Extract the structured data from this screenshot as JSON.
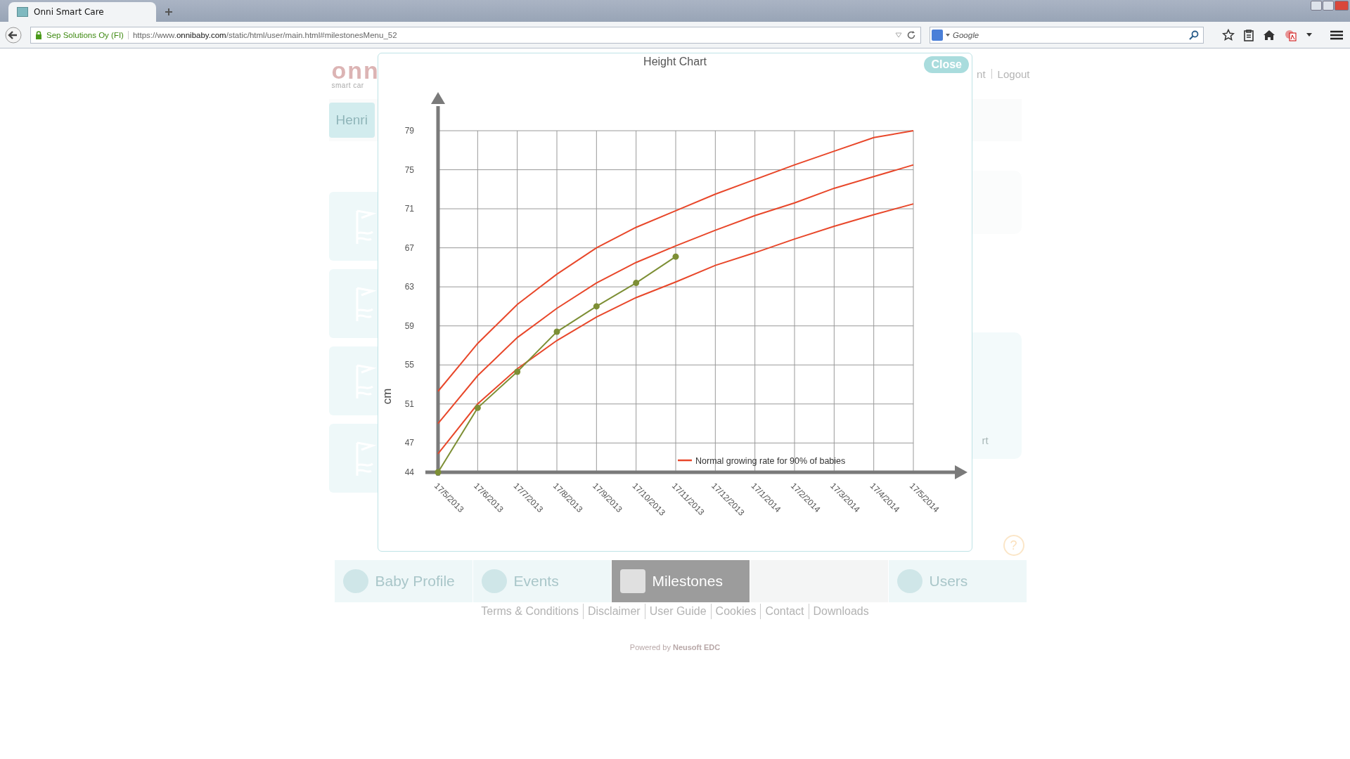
{
  "browser": {
    "tab_title": "Onni Smart Care",
    "identity": "Sep Solutions Oy (FI)",
    "url_prefix": "https://www.",
    "url_domain": "onnibaby.com",
    "url_path": "/static/html/user/main.html#milestonesMenu_52",
    "search_placeholder": "Google"
  },
  "page": {
    "logo": {
      "text": "onn",
      "tagline": "smart car"
    },
    "header_links": [
      "nt",
      "Logout"
    ],
    "profile_name": "Henri",
    "side_fragment": "rt",
    "help": "?",
    "nav_tabs": [
      {
        "label": "Baby Profile",
        "selected": false
      },
      {
        "label": "Events",
        "selected": false
      },
      {
        "label": "Milestones",
        "selected": true
      },
      {
        "label": "Users",
        "selected": false
      }
    ],
    "footer_links": [
      "Terms & Conditions",
      "Disclaimer",
      "User Guide",
      "Cookies",
      "Contact",
      "Downloads"
    ],
    "powered_by": "Powered by **Neusoft EDC**"
  },
  "modal": {
    "title": "Height Chart",
    "close": "Close",
    "chart_data": {
      "type": "line",
      "ylabel": "cm",
      "categories": [
        "17/5/2013",
        "17/6/2013",
        "17/7/2013",
        "17/8/2013",
        "17/9/2013",
        "17/10/2013",
        "17/11/2013",
        "17/12/2013",
        "17/1/2014",
        "17/2/2014",
        "17/3/2014",
        "17/4/2014",
        "17/5/2014"
      ],
      "grid": true,
      "ylim": [
        44,
        79
      ],
      "yticks": [
        44,
        47,
        51,
        55,
        59,
        63,
        67,
        71,
        75,
        79
      ],
      "series": [
        {
          "name": "Normal growing rate for 90% of babies",
          "color": "#e8472a",
          "values": [
            52.3,
            57.2,
            61.2,
            64.3,
            67.0,
            69.1,
            70.8,
            72.5,
            74.0,
            75.5,
            76.9,
            78.3,
            79.0
          ]
        },
        {
          "color": "#e8472a",
          "values": [
            49.0,
            53.9,
            57.8,
            60.8,
            63.4,
            65.5,
            67.2,
            68.8,
            70.3,
            71.6,
            73.1,
            74.3,
            75.5
          ]
        },
        {
          "color": "#e8472a",
          "values": [
            45.9,
            51.0,
            54.6,
            57.5,
            59.9,
            61.9,
            63.5,
            65.2,
            66.5,
            67.9,
            69.2,
            70.4,
            71.5
          ]
        },
        {
          "color": "#7d8f35",
          "marker": "circle",
          "values": [
            44,
            50.6,
            54.3,
            58.4,
            61.0,
            63.4,
            66.1,
            null,
            null,
            null,
            null,
            null,
            null
          ]
        }
      ]
    }
  }
}
